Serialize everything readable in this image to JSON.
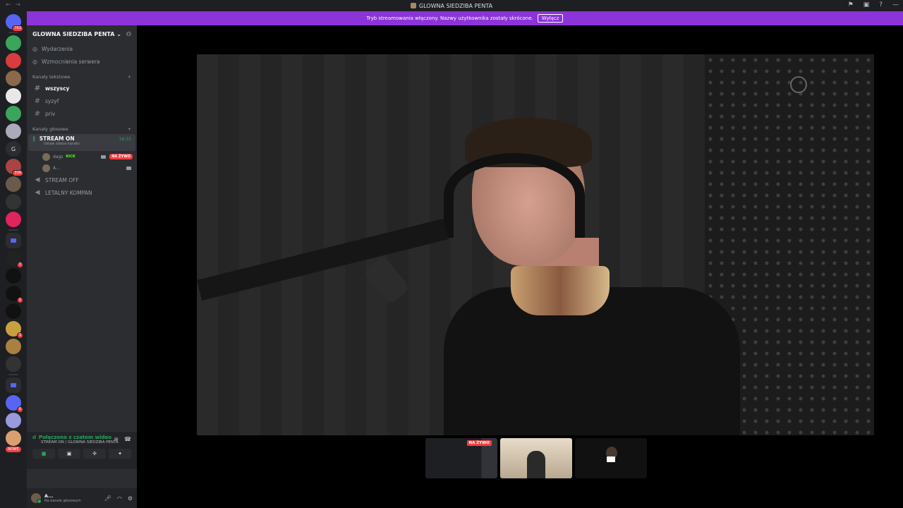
{
  "titlebar": {
    "title": "GLOWNA SIEDZIBA PENTA"
  },
  "banner": {
    "text": "Tryb streamowania włączony. Nazwy użytkownika zostały skrócone.",
    "button": "Wyłącz"
  },
  "guilds": [
    {
      "name": "home",
      "color": "#5865f2",
      "badge": "763"
    },
    {
      "name": "guild-2",
      "color": "#3ba55c",
      "badge": ""
    },
    {
      "name": "guild-3",
      "color": "#d83c3e",
      "badge": ""
    },
    {
      "name": "guild-4",
      "color": "#8a6a4a",
      "badge": ""
    },
    {
      "name": "guild-5",
      "color": "#e8e8e8",
      "badge": ""
    },
    {
      "name": "guild-6",
      "color": "#3ba55c",
      "badge": ""
    },
    {
      "name": "guild-7",
      "color": "#aab",
      "badge": ""
    },
    {
      "name": "guild-8",
      "letter": "G"
    },
    {
      "name": "guild-9",
      "color": "#a44",
      "badge": "336"
    },
    {
      "name": "guild-10",
      "color": "#6a5a4a",
      "badge": ""
    },
    {
      "name": "guild-11",
      "color": "#333",
      "badge": ""
    },
    {
      "name": "guild-12",
      "color": "#e0245e",
      "badge": ""
    },
    {
      "name": "folder-1",
      "folder": true
    },
    {
      "name": "guild-13",
      "color": "#222",
      "badge": "7"
    },
    {
      "name": "guild-14",
      "color": "#111",
      "badge": ""
    },
    {
      "name": "guild-15",
      "color": "#111",
      "badge": "1"
    },
    {
      "name": "guild-16",
      "color": "#111",
      "badge": ""
    },
    {
      "name": "guild-17",
      "color": "#c8a040",
      "badge": "1"
    },
    {
      "name": "guild-18",
      "color": "#a88040",
      "badge": ""
    },
    {
      "name": "guild-19",
      "color": "#333",
      "badge": ""
    },
    {
      "name": "folder-2",
      "folder": true
    },
    {
      "name": "guild-20",
      "color": "#5865f2",
      "badge": "6"
    },
    {
      "name": "guild-21",
      "color": "#9999dd",
      "badge": ""
    },
    {
      "name": "guild-22",
      "color": "#d8a070",
      "badge": ""
    }
  ],
  "guilds_new_label": "NOWE",
  "server": {
    "name": "GLOWNA SIEDZIBA PENTA",
    "chevron": "⌄"
  },
  "menu": [
    {
      "icon": "calendar-icon",
      "label": "Wydarzenia"
    },
    {
      "icon": "boost-icon",
      "label": "Wzmocnienia serwera"
    }
  ],
  "text_category": "Kanały tekstowe",
  "text_channels": [
    {
      "label": "wszyscy",
      "active": true
    },
    {
      "label": "syzyf",
      "active": false
    },
    {
      "label": "priv",
      "active": false
    }
  ],
  "voice_category": "Kanały głosowe",
  "active_voice": {
    "label": "STREAM ON",
    "status": "Ustaw status kanału",
    "time": "16:33"
  },
  "members": [
    {
      "name": "dags",
      "tag": "KICK",
      "live": "NA ŻYWO"
    },
    {
      "name": "A...",
      "tag": "",
      "live": ""
    }
  ],
  "voice_channels": [
    {
      "label": "STREAM OFF"
    },
    {
      "label": "LETALNY KOMPAN"
    }
  ],
  "connection": {
    "title": "Połączono z czatem wideo",
    "sub": "STREAM ON / GLOWNA SIEDZIBA PENTA"
  },
  "user": {
    "name": "A...",
    "status": "Na kanale głosowym"
  },
  "thumbnails": {
    "live_label": "NA ŻYWO"
  },
  "colors": {
    "accent": "#8c33d9",
    "connected": "#23a55a",
    "live": "#f23f43",
    "kick": "#53fc18"
  }
}
